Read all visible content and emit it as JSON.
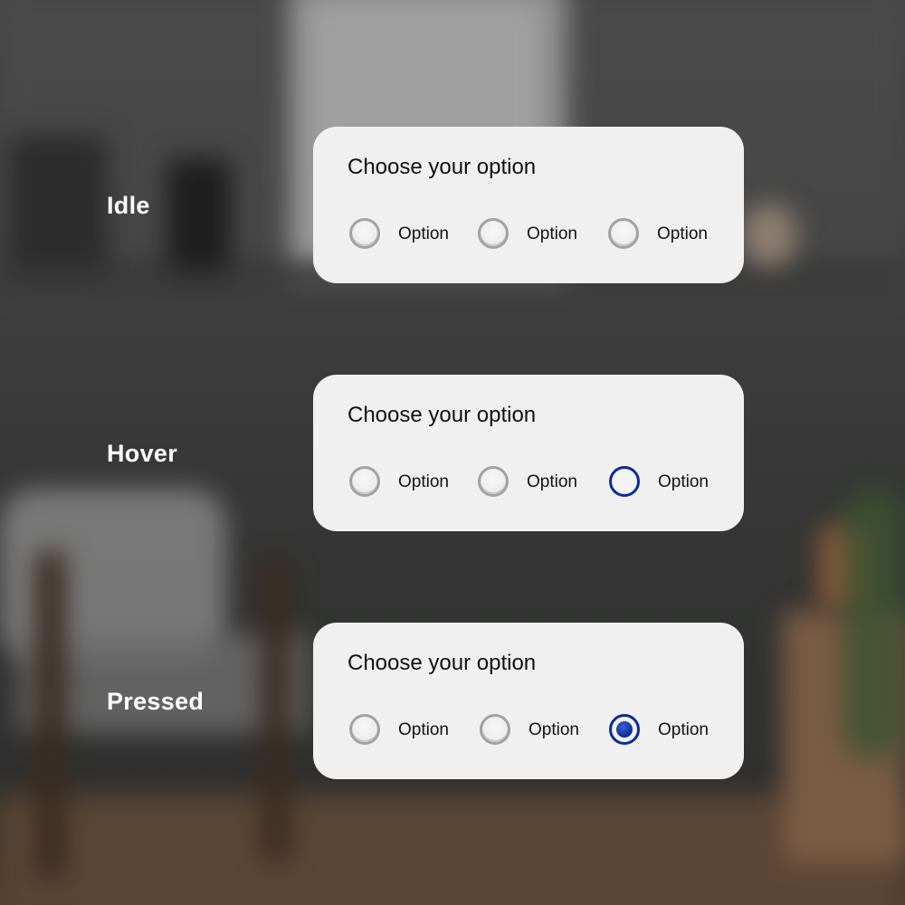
{
  "states": [
    {
      "label": "Idle",
      "card": {
        "title": "Choose your option",
        "options": [
          {
            "label": "Option",
            "state": "idle"
          },
          {
            "label": "Option",
            "state": "idle"
          },
          {
            "label": "Option",
            "state": "idle"
          }
        ]
      }
    },
    {
      "label": "Hover",
      "card": {
        "title": "Choose your option",
        "options": [
          {
            "label": "Option",
            "state": "idle"
          },
          {
            "label": "Option",
            "state": "idle"
          },
          {
            "label": "Option",
            "state": "hover"
          }
        ]
      }
    },
    {
      "label": "Pressed",
      "card": {
        "title": "Choose your option",
        "options": [
          {
            "label": "Option",
            "state": "idle"
          },
          {
            "label": "Option",
            "state": "idle"
          },
          {
            "label": "Option",
            "state": "selected"
          }
        ]
      }
    }
  ],
  "colors": {
    "accent": "#0b2a9a",
    "card_background": "#f0f0f0",
    "radio_idle_border": "#a2a2a2",
    "label_text": "#ffffff"
  }
}
